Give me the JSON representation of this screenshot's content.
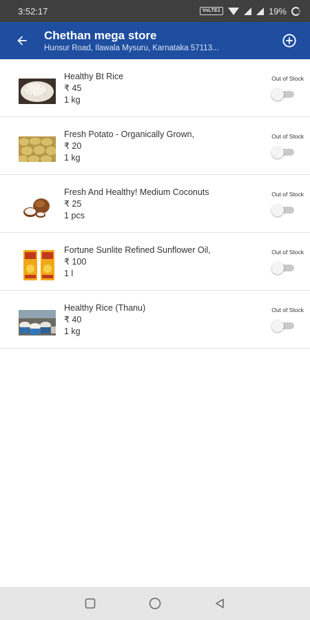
{
  "status_bar": {
    "time": "3:52:17",
    "network_badge": "VoLTE1",
    "battery": "19%",
    "icons": [
      "wifi-icon",
      "signal-icon",
      "battery-icon"
    ]
  },
  "app_bar": {
    "title": "Chethan mega store",
    "subtitle": "Hunsur Road, Ilawala Mysuru, Karnataka 57113...",
    "back_icon": "arrow-left-icon",
    "add_icon": "add-circle-icon",
    "color": "#1f4ea0"
  },
  "products": [
    {
      "name": "Healthy Bt Rice",
      "price": "₹ 45",
      "qty": "1 kg",
      "stock_label": "Out of Stock",
      "image": "rice-grains"
    },
    {
      "name": "Fresh Potato - Organically Grown,",
      "price": "₹ 20",
      "qty": "1 kg",
      "stock_label": "Out of Stock",
      "image": "potatoes"
    },
    {
      "name": "Fresh And Healthy! Medium Coconuts",
      "price": "₹ 25",
      "qty": "1 pcs",
      "stock_label": "Out of Stock",
      "image": "coconut"
    },
    {
      "name": "Fortune Sunlite Refined Sunflower Oil,",
      "price": "₹ 100",
      "qty": "1 l",
      "stock_label": "Out of Stock",
      "image": "oil-pouch"
    },
    {
      "name": "Healthy Rice (Thanu)",
      "price": "₹ 40",
      "qty": "1 kg",
      "stock_label": "Out of Stock",
      "image": "rice-market"
    }
  ],
  "nav_bar": {
    "icons": [
      "recents-square-icon",
      "home-circle-icon",
      "back-triangle-icon"
    ]
  }
}
